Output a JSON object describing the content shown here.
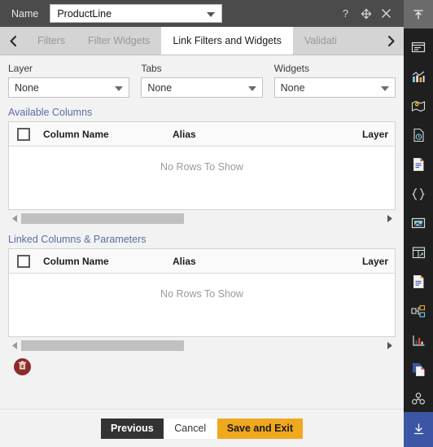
{
  "titlebar": {
    "name_label": "Name",
    "name_value": "ProductLine",
    "help_icon": "question-mark-icon",
    "move_icon": "move-icon",
    "close_icon": "close-icon"
  },
  "tabs": {
    "prev_icon": "chevron-left-icon",
    "next_icon": "chevron-right-icon",
    "items": [
      {
        "label": "Filters",
        "active": false
      },
      {
        "label": "Filter Widgets",
        "active": false
      },
      {
        "label": "Link Filters and Widgets",
        "active": true
      },
      {
        "label": "Validati",
        "active": false
      }
    ]
  },
  "filters": [
    {
      "label": "Layer",
      "value": "None"
    },
    {
      "label": "Tabs",
      "value": "None"
    },
    {
      "label": "Widgets",
      "value": "None"
    }
  ],
  "available_columns": {
    "title": "Available Columns",
    "headers": [
      "Column Name",
      "Alias",
      "Layer"
    ],
    "empty_message": "No Rows To Show",
    "rows": []
  },
  "linked_columns": {
    "title": "Linked Columns & Parameters",
    "headers": [
      "Column Name",
      "Alias",
      "Layer"
    ],
    "empty_message": "No Rows To Show",
    "rows": []
  },
  "delete_button": {
    "icon": "trash-icon",
    "color": "#8c2b2b"
  },
  "footer": {
    "previous_label": "Previous",
    "cancel_label": "Cancel",
    "save_label": "Save and Exit",
    "save_color": "#f0a81e",
    "previous_color": "#333333"
  },
  "rail": {
    "collapse_icon": "arrow-up-to-bar-icon",
    "items": [
      "panel-icon",
      "bar-chart-icon",
      "map-pin-icon",
      "report-clock-icon",
      "document-icon",
      "code-braces-icon",
      "image-icon",
      "table-icon",
      "file-text-icon",
      "hierarchy-icon",
      "line-chart-icon",
      "copy-page-icon",
      "cluster-icon",
      "rx-icon"
    ],
    "download_icon": "download-icon",
    "download_color": "#3c56a5"
  }
}
